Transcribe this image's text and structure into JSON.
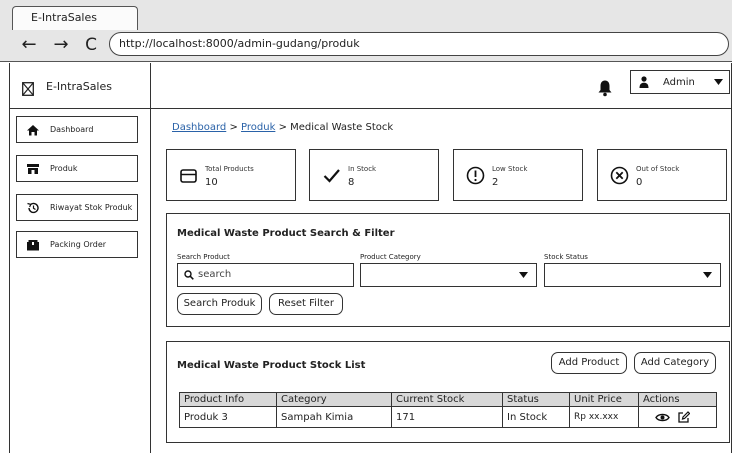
{
  "browser": {
    "tab_title": "E-IntraSales",
    "back_label": "←",
    "forward_label": "→",
    "reload_label": "C",
    "url": "http://localhost:8000/admin-gudang/produk"
  },
  "brand": {
    "name": "E-IntraSales"
  },
  "sidebar": {
    "items": [
      {
        "label": "Dashboard",
        "icon": "home-icon"
      },
      {
        "label": "Produk",
        "icon": "store-icon"
      },
      {
        "label": "Riwayat Stok Produk",
        "icon": "history-icon"
      },
      {
        "label": "Packing Order",
        "icon": "package-icon"
      }
    ]
  },
  "header": {
    "user_label": "Admin"
  },
  "breadcrumb": {
    "items": [
      "Dashboard",
      "Produk",
      "Medical Waste Stock"
    ],
    "separator": ">"
  },
  "stats": [
    {
      "label": "Total Products",
      "value": "10",
      "icon": "box-icon"
    },
    {
      "label": "In Stock",
      "value": "8",
      "icon": "check-icon"
    },
    {
      "label": "Low Stock",
      "value": "2",
      "icon": "alert-circle-icon"
    },
    {
      "label": "Out of Stock",
      "value": "0",
      "icon": "x-circle-icon"
    }
  ],
  "filter": {
    "title": "Medical Waste Product Search & Filter",
    "search_label": "Search Product",
    "search_placeholder": "search",
    "category_label": "Product Category",
    "category_value": "",
    "status_label": "Stock Status",
    "status_value": "",
    "search_button": "Search Produk",
    "reset_button": "Reset Filter"
  },
  "list": {
    "title": "Medical Waste Product Stock List",
    "add_product_button": "Add Product",
    "add_category_button": "Add Category",
    "columns": [
      "Product Info",
      "Category",
      "Current Stock",
      "Status",
      "Unit Price",
      "Actions"
    ],
    "rows": [
      {
        "product": "Produk 3",
        "category": "Sampah Kimia",
        "stock": "171",
        "status": "In Stock",
        "price": "Rp xx.xxx"
      }
    ]
  },
  "colors": {
    "link": "#2a62a8",
    "table_header_bg": "#d8d8d8",
    "chrome_bg": "#e6e6e6"
  }
}
